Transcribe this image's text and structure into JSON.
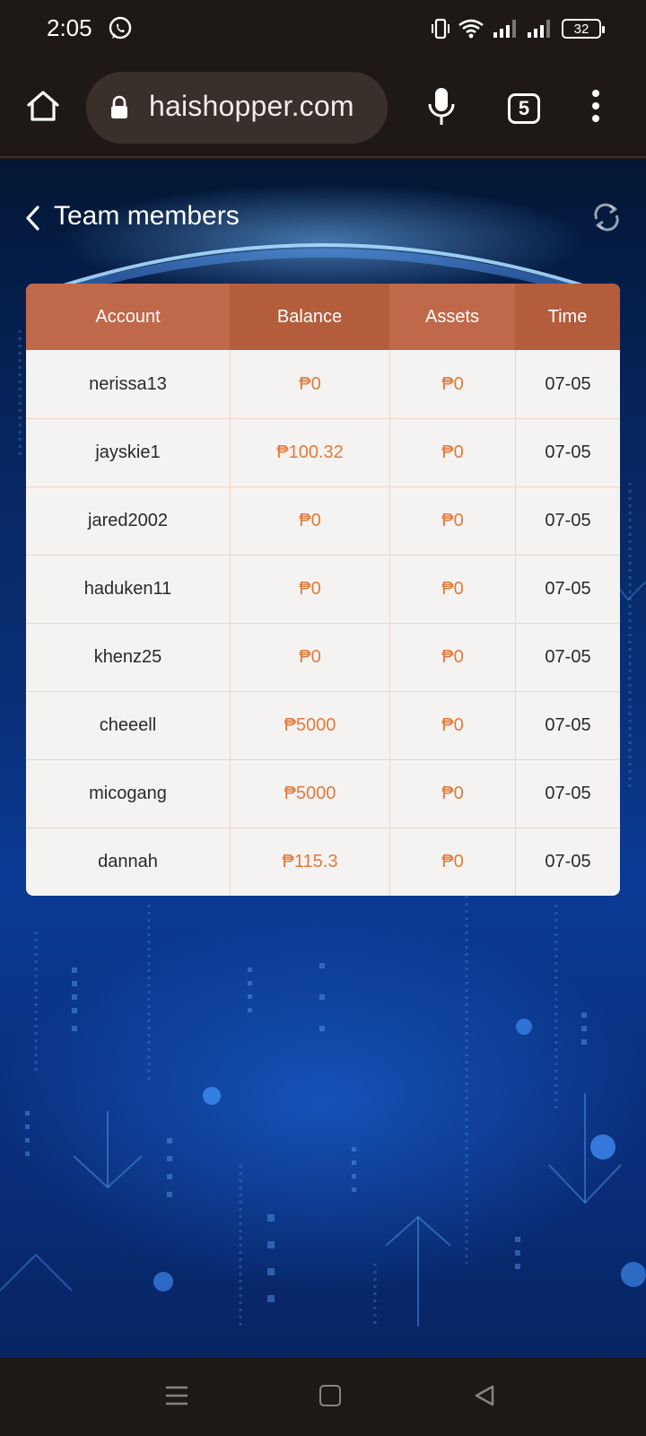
{
  "status_bar": {
    "time": "2:05",
    "battery": "32",
    "icons": [
      "whatsapp-icon",
      "vibrate-icon",
      "wifi-icon",
      "signal-icon",
      "signal-icon-2",
      "battery-icon"
    ]
  },
  "browser": {
    "url": "haishopper.com",
    "tab_count": "5",
    "icons": [
      "home-icon",
      "lock-icon",
      "mic-icon",
      "tabs-icon",
      "menu-icon"
    ]
  },
  "page": {
    "title": "Team members",
    "icons": [
      "back-icon",
      "refresh-icon"
    ]
  },
  "table": {
    "columns": [
      "Account",
      "Balance",
      "Assets",
      "Time"
    ],
    "rows": [
      {
        "account": "nerissa13",
        "balance": "₱0",
        "assets": "₱0",
        "time": "07-05"
      },
      {
        "account": "jayskie1",
        "balance": "₱100.32",
        "assets": "₱0",
        "time": "07-05"
      },
      {
        "account": "jared2002",
        "balance": "₱0",
        "assets": "₱0",
        "time": "07-05"
      },
      {
        "account": "haduken11",
        "balance": "₱0",
        "assets": "₱0",
        "time": "07-05"
      },
      {
        "account": "khenz25",
        "balance": "₱0",
        "assets": "₱0",
        "time": "07-05"
      },
      {
        "account": "cheeell",
        "balance": "₱5000",
        "assets": "₱0",
        "time": "07-05"
      },
      {
        "account": "micogang",
        "balance": "₱5000",
        "assets": "₱0",
        "time": "07-05"
      },
      {
        "account": "dannah",
        "balance": "₱115.3",
        "assets": "₱0",
        "time": "07-05"
      }
    ]
  },
  "nav_bar": {
    "icons": [
      "recents-icon",
      "home-nav-icon",
      "back-nav-icon"
    ]
  },
  "colors": {
    "header_primary": "#c0694a",
    "header_secondary": "#b35d3d",
    "money_text": "#e07b3c",
    "row_divider": "#f3d4c3",
    "browser_bar": "#1e1916"
  }
}
